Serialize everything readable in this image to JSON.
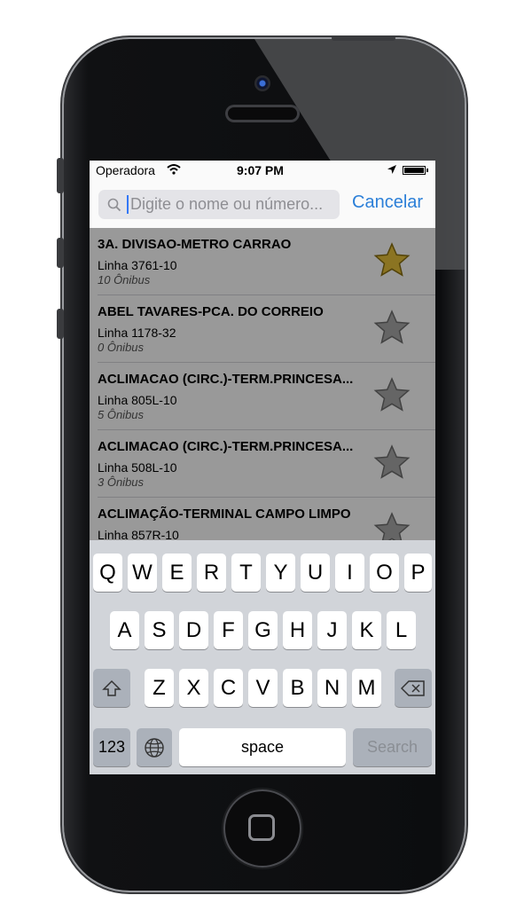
{
  "status_bar": {
    "carrier": "Operadora",
    "time": "9:07 PM"
  },
  "search": {
    "placeholder": "Digite o nome ou número...",
    "cancel_label": "Cancelar"
  },
  "results": [
    {
      "title": "3A. DIVISAO-METRO CARRAO",
      "line": "Linha 3761-10",
      "buses": "10 Ônibus",
      "favorite": true
    },
    {
      "title": "ABEL TAVARES-PCA. DO CORREIO",
      "line": "Linha 1178-32",
      "buses": "0 Ônibus",
      "favorite": false
    },
    {
      "title": "ACLIMACAO (CIRC.)-TERM.PRINCESA...",
      "line": "Linha 805L-10",
      "buses": "5 Ônibus",
      "favorite": false
    },
    {
      "title": "ACLIMACAO (CIRC.)-TERM.PRINCESA...",
      "line": "Linha 508L-10",
      "buses": "3 Ônibus",
      "favorite": false
    },
    {
      "title": "ACLIMAÇÃO-TERMINAL CAMPO LIMPO",
      "line": "Linha 857R-10",
      "buses": "",
      "favorite": false
    }
  ],
  "keyboard": {
    "row1": [
      "Q",
      "W",
      "E",
      "R",
      "T",
      "Y",
      "U",
      "I",
      "O",
      "P"
    ],
    "row2": [
      "A",
      "S",
      "D",
      "F",
      "G",
      "H",
      "J",
      "K",
      "L"
    ],
    "row3": [
      "Z",
      "X",
      "C",
      "V",
      "B",
      "N",
      "M"
    ],
    "numbers_label": "123",
    "space_label": "space",
    "search_label": "Search",
    "shift_icon": "shift-icon",
    "delete_icon": "backspace-icon",
    "globe_icon": "globe-icon"
  },
  "colors": {
    "accent": "#2b7fd8",
    "favorite_star": "#d9b52a",
    "inactive_star": "#9a9a9a"
  }
}
